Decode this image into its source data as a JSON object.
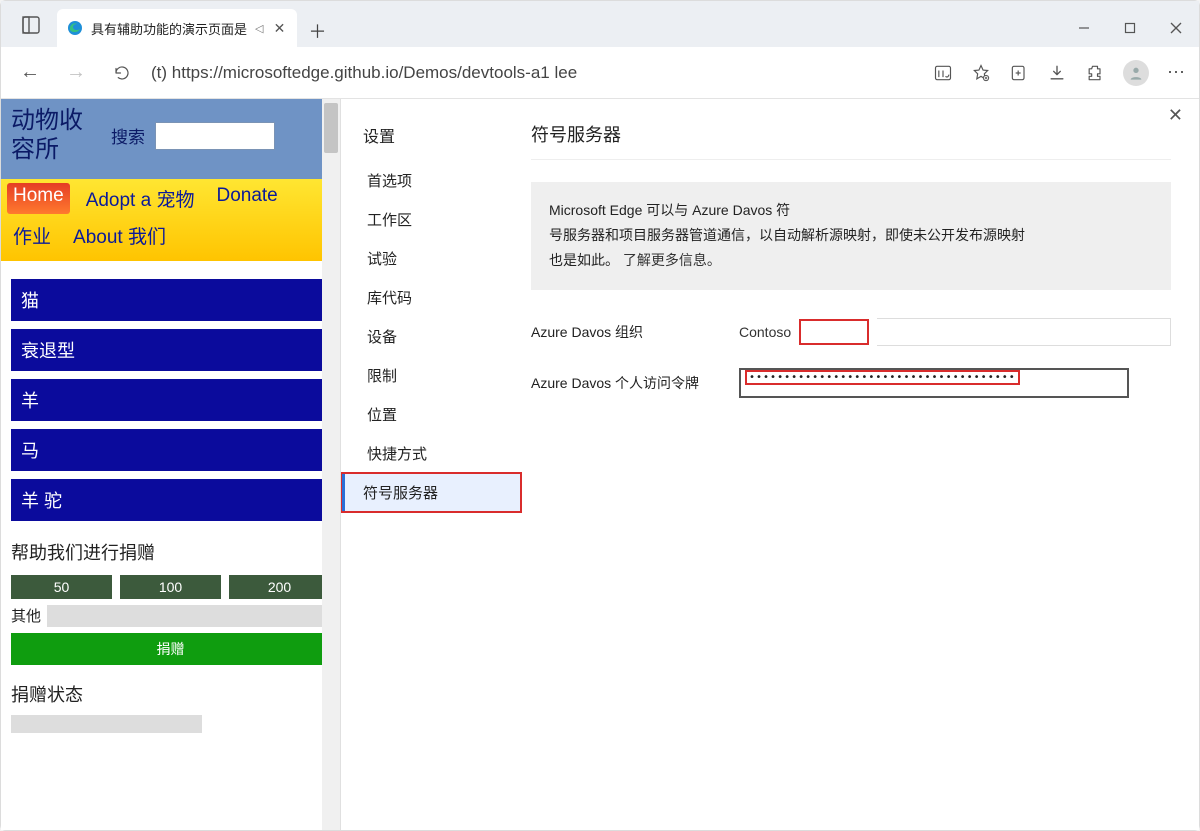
{
  "tab": {
    "title": "具有辅助功能的演示页面是"
  },
  "url": "(t) https://microsoftedge.github.io/Demos/devtools-a1 lee",
  "demo": {
    "logo_line1": "动物收",
    "logo_line2": "容所",
    "search_label": "搜索",
    "nav": {
      "home": "Home",
      "adopt": "Adopt a 宠物",
      "donate": "Donate",
      "jobs": "作业",
      "about": "About 我们"
    },
    "categories": [
      "猫",
      "衰退型",
      "羊",
      "马",
      "羊 驼"
    ],
    "donate": {
      "heading": "帮助我们进行捐赠",
      "a1": "50",
      "a2": "100",
      "a3": "200",
      "other_label": "其他",
      "submit": "捐赠",
      "status_heading": "捐赠状态"
    }
  },
  "devtools": {
    "settings_heading": "设置",
    "menu": {
      "preferences": "首选项",
      "workspace": "工作区",
      "experiments": "试验",
      "library": "库代码",
      "device": "设备",
      "throttling": "限制",
      "locations": "位置",
      "shortcuts": "快捷方式",
      "symbol_server": "符号服务器"
    },
    "page": {
      "title": "符号服务器",
      "info_l1": "Microsoft Edge 可以与 Azure Davos 符",
      "info_l2": "号服务器和项目服务器管道通信，以自动解析源映射，即使未公开发布源映射",
      "info_l3": "也是如此。",
      "info_link": "了解更多信息。",
      "org_label": "Azure Davos 组织",
      "org_value": "Contoso",
      "pat_label": "Azure Davos 个人访问令牌",
      "pat_value": "••••••••••••••••••••••••••••••••••••••"
    }
  }
}
